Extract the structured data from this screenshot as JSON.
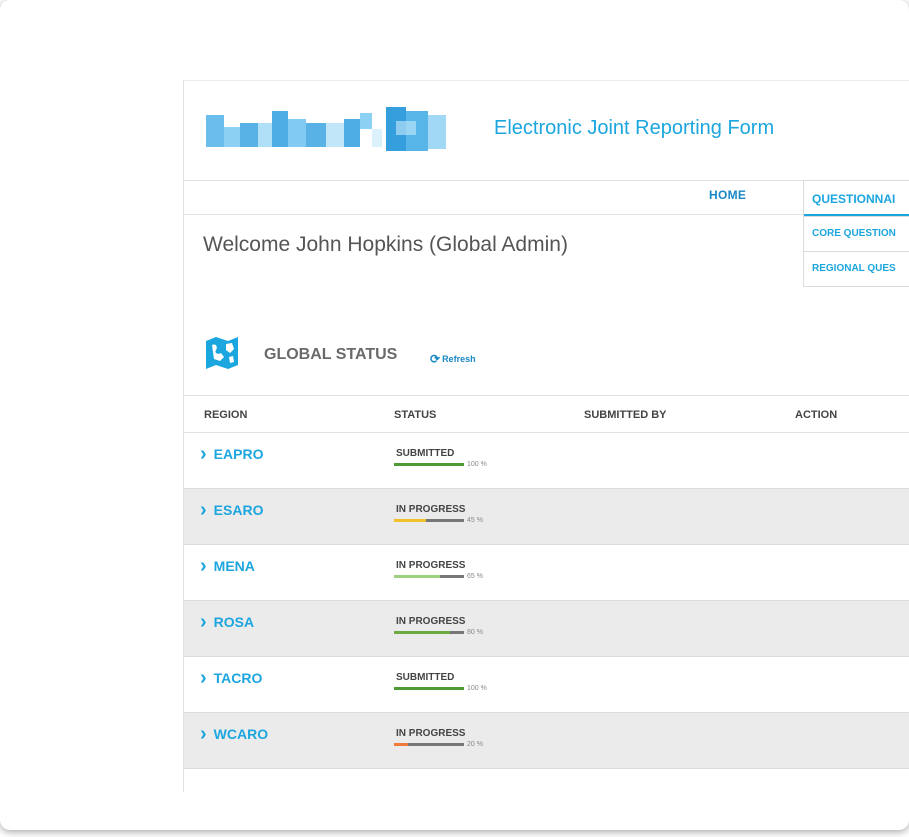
{
  "header": {
    "app_title": "Electronic Joint Reporting Form",
    "brand_color": "#1ca6df"
  },
  "nav": {
    "home": "HOME",
    "questionnaires": "QUESTIONNAI",
    "core": "CORE QUESTION",
    "regional": "REGIONAL QUES"
  },
  "welcome": "Welcome John Hopkins (Global Admin)",
  "global_status": {
    "title": "GLOBAL STATUS",
    "refresh": "Refresh",
    "icon": "map-icon"
  },
  "table": {
    "headers": [
      "REGION",
      "STATUS",
      "SUBMITTED BY",
      "ACTION"
    ],
    "rows": [
      {
        "region": "EAPRO",
        "status": "SUBMITTED",
        "progress": 100,
        "pct_label": "100 %",
        "color": "#4e9b35"
      },
      {
        "region": "ESARO",
        "status": "IN PROGRESS",
        "progress": 45,
        "pct_label": "45 %",
        "color": "#f1c02a"
      },
      {
        "region": "MENA",
        "status": "IN PROGRESS",
        "progress": 65,
        "pct_label": "65 %",
        "color": "#9fd07e"
      },
      {
        "region": "ROSA",
        "status": "IN PROGRESS",
        "progress": 80,
        "pct_label": "80 %",
        "color": "#6bab3f"
      },
      {
        "region": "TACRO",
        "status": "SUBMITTED",
        "progress": 100,
        "pct_label": "100 %",
        "color": "#4e9b35"
      },
      {
        "region": "WCARO",
        "status": "IN PROGRESS",
        "progress": 20,
        "pct_label": "20 %",
        "color": "#f07a3a"
      }
    ]
  }
}
